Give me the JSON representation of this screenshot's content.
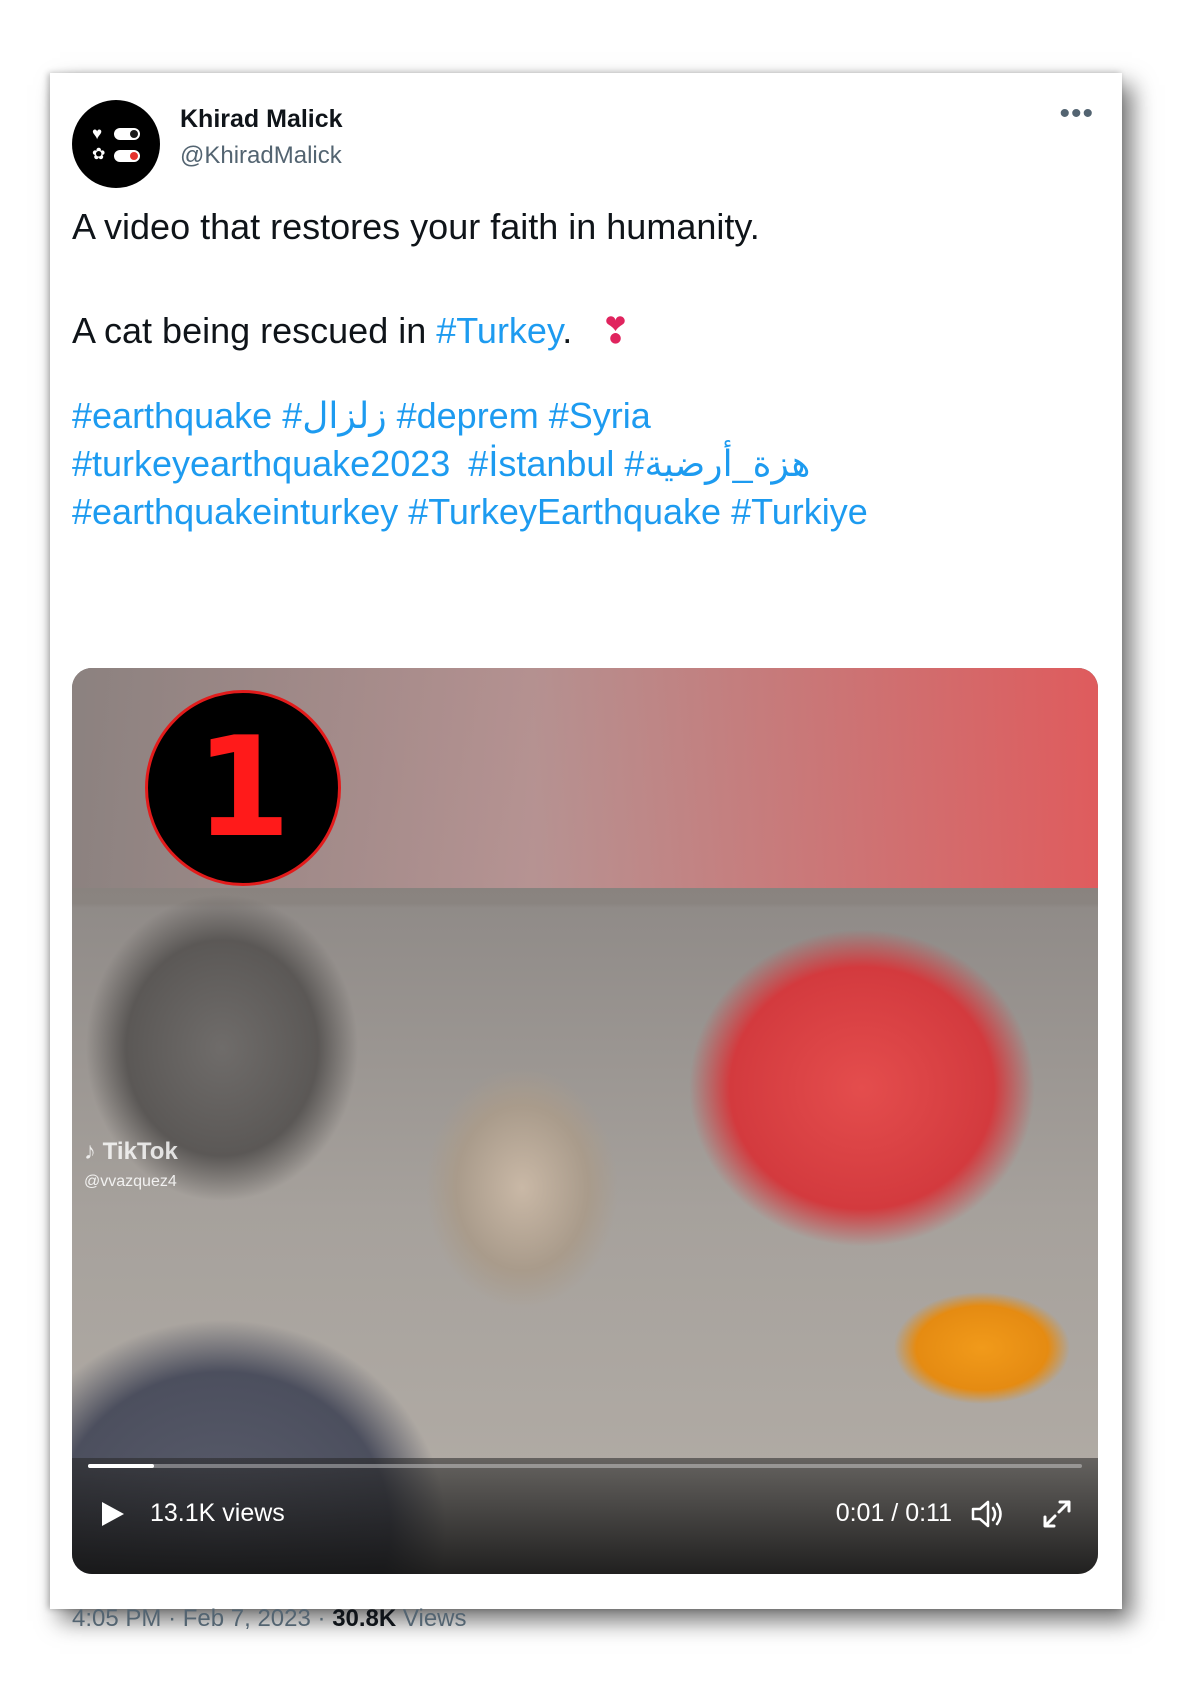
{
  "author": {
    "name": "Khirad Malick",
    "handle": "@KhiradMalick",
    "avatar_icon": "heart-brain-toggle-icon"
  },
  "more_icon": "more-horizontal-icon",
  "tweet": {
    "line1": "A video that restores your faith in humanity.",
    "line2_prefix": "A cat being rescued in ",
    "line2_tag": "#Turkey",
    "line2_suffix": ".",
    "line2_emoji": "❣️",
    "hashtags_line1": [
      "#earthquake",
      "#زلزال",
      "#deprem",
      "#Syria"
    ],
    "hashtags_line2": [
      "#turkeyearthquake2023",
      "#İstanbul",
      "#هزة_أرضية"
    ],
    "hashtags_line3": [
      "#earthquakeinturkey",
      "#TurkeyEarthquake",
      "#Turkiye"
    ]
  },
  "video": {
    "badge_number": "1",
    "watermark_brand": "TikTok",
    "watermark_user": "@vvazquez4",
    "views": "13.1K views",
    "time": "0:01 / 0:11",
    "progress": 0.066,
    "icons": {
      "play": "play-icon",
      "volume": "volume-icon",
      "fullscreen": "fullscreen-icon"
    }
  },
  "footer": {
    "time": "4:05 PM",
    "sep": "·",
    "date": "Feb 7, 2023",
    "views_count": "30.8K",
    "views_label": "Views"
  },
  "colors": {
    "link": "#1d9bf0",
    "text": "#0f1419",
    "secondary": "#536471",
    "badge_red": "#ff1a1a"
  }
}
